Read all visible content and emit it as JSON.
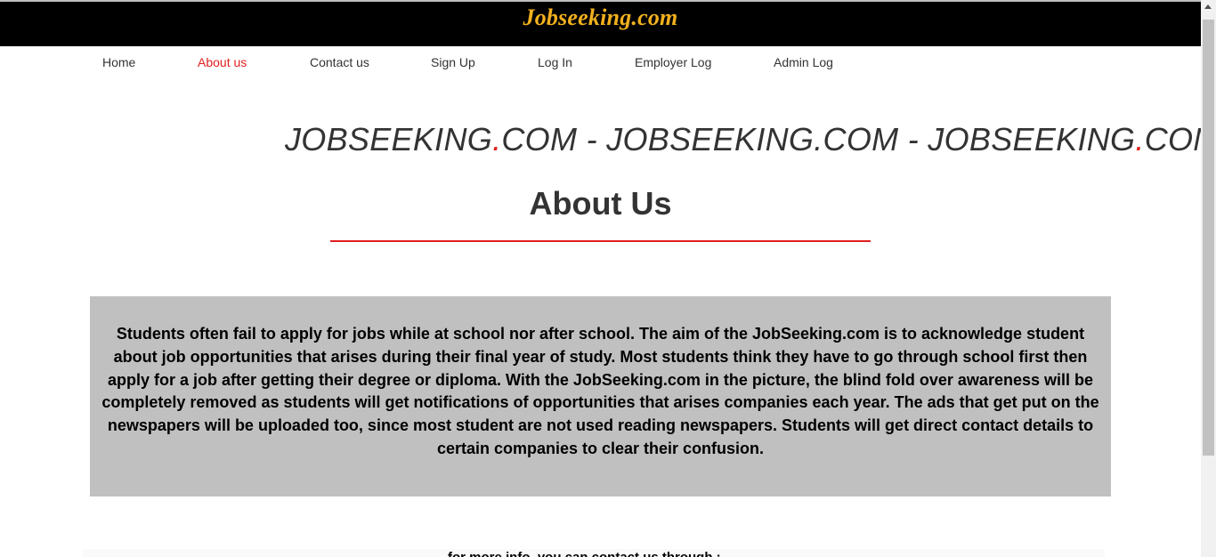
{
  "header": {
    "brand": "Jobseeking.com"
  },
  "nav": {
    "items": [
      {
        "label": "Home"
      },
      {
        "label": "About us"
      },
      {
        "label": "Contact us"
      },
      {
        "label": "Sign Up"
      },
      {
        "label": "Log In"
      },
      {
        "label": "Employer Log"
      },
      {
        "label": "Admin Log"
      }
    ],
    "active": "About us"
  },
  "marquee": {
    "segment_1_a": "JOBSEEKING",
    "segment_1_dot": ".",
    "segment_1_b": "COM - JOBSEEKING.COM - JOBSEEKING",
    "segment_2_dot": ".",
    "segment_2_b": "COM"
  },
  "about": {
    "title": "About Us",
    "body": "Students often fail to apply for jobs while at school nor after school. The aim of the JobSeeking.com is to acknowledge student about job opportunities that arises during their final year of study. Most students think they have to go through school first then apply for a job after getting their degree or diploma. With the JobSeeking.com in the picture, the blind fold over awareness will be completely removed as students will get notifications of opportunities that arises companies each year. The ads that get put on the newspapers will be uploaded too, since most student are not used reading newspapers. Students will get direct contact details to certain companies to clear their confusion."
  },
  "contact": {
    "line": "for more info, you can contact us through :"
  },
  "colors": {
    "header_bg": "#000000",
    "brand": "#f2b01e",
    "accent": "#e02020",
    "about_box_bg": "#c0c0c0"
  }
}
